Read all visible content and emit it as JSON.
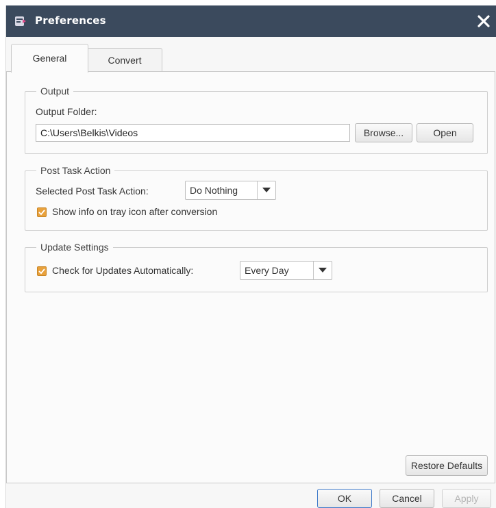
{
  "window": {
    "title": "Preferences",
    "app_icon": "film-app-icon",
    "close_icon": "close-icon",
    "accent_color": "#3b4a5d"
  },
  "tabs": [
    {
      "label": "General",
      "active": true
    },
    {
      "label": "Convert",
      "active": false
    }
  ],
  "output": {
    "legend": "Output",
    "folder_label": "Output Folder:",
    "folder_value": "C:\\Users\\Belkis\\Videos",
    "browse_label": "Browse...",
    "open_label": "Open"
  },
  "post_task": {
    "legend": "Post Task Action",
    "selected_label": "Selected Post Task Action:",
    "selected_value": "Do Nothing",
    "tray_info_label": "Show info on tray icon after conversion",
    "tray_info_checked": true
  },
  "updates": {
    "legend": "Update Settings",
    "check_label": "Check for Updates Automatically:",
    "check_checked": true,
    "frequency_value": "Every Day"
  },
  "footer": {
    "restore_label": "Restore Defaults",
    "ok_label": "OK",
    "cancel_label": "Cancel",
    "apply_label": "Apply"
  },
  "checkbox_color": "#e8a13c"
}
